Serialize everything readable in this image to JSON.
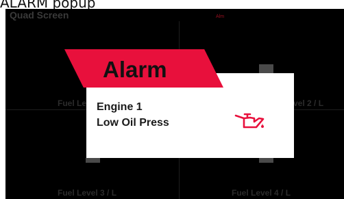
{
  "caption": "ALARM popup",
  "screen": {
    "title": "Quad Screen",
    "top_indicator": "Alm",
    "quadrants": [
      {
        "label": "Fuel Level 1 / L"
      },
      {
        "label": "Fuel Level 2 / L"
      },
      {
        "label": "Fuel Level 3 / L"
      },
      {
        "label": "Fuel Level 4 / L"
      }
    ]
  },
  "alarm": {
    "banner_title": "Alarm",
    "source": "Engine 1",
    "message": "Low Oil Press",
    "icon": "oil-can-icon",
    "accent_color": "#e8103c"
  }
}
